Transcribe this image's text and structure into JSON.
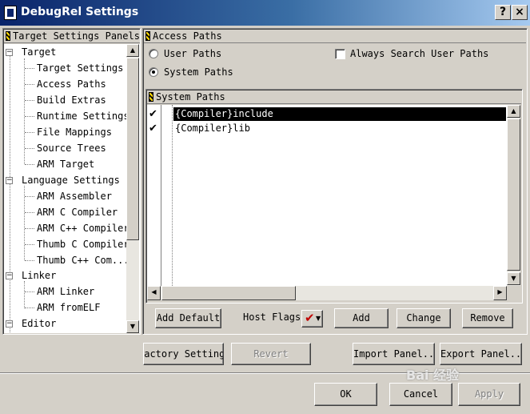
{
  "window": {
    "title": "DebugRel Settings",
    "help_label": "?",
    "close_label": "×"
  },
  "left_panel": {
    "header": "Target Settings Panels"
  },
  "tree": {
    "items": [
      {
        "label": "Target",
        "expander": "−"
      },
      {
        "label": "Target Settings"
      },
      {
        "label": "Access Paths"
      },
      {
        "label": "Build Extras"
      },
      {
        "label": "Runtime Settings"
      },
      {
        "label": "File Mappings"
      },
      {
        "label": "Source Trees"
      },
      {
        "label": "ARM Target"
      },
      {
        "label": "Language Settings",
        "expander": "−"
      },
      {
        "label": "ARM Assembler"
      },
      {
        "label": "ARM C Compiler"
      },
      {
        "label": "ARM C++ Compiler"
      },
      {
        "label": "Thumb C Compiler"
      },
      {
        "label": "Thumb C++ Com..."
      },
      {
        "label": "Linker",
        "expander": "−"
      },
      {
        "label": "ARM Linker"
      },
      {
        "label": "ARM fromELF"
      },
      {
        "label": "Editor",
        "expander": "−"
      }
    ]
  },
  "right_panel": {
    "header": "Access Paths"
  },
  "options": {
    "user_paths": "User Paths",
    "system_paths": "System Paths",
    "always_search": "Always Search User Paths",
    "selected": "system_paths",
    "always_search_checked": false
  },
  "path_list": {
    "header": "System Paths",
    "rows": [
      {
        "path": "{Compiler}include",
        "checked": true,
        "selected": true
      },
      {
        "path": "{Compiler}lib",
        "checked": true,
        "selected": false
      }
    ]
  },
  "path_buttons": {
    "add_default": "Add Default",
    "host_flags_label": "Host Flags:",
    "add": "Add",
    "change": "Change",
    "remove": "Remove"
  },
  "panel_buttons": {
    "factory_settings": "Factory Settings",
    "revert": "Revert",
    "import_panel": "Import Panel...",
    "export_panel": "Export Panel..."
  },
  "dialog_buttons": {
    "ok": "OK",
    "cancel": "Cancel",
    "apply": "Apply"
  },
  "watermark": "Bai 经验",
  "colors": {
    "title_start": "#0a246a",
    "title_end": "#a6caf0",
    "selection": "#000000",
    "face": "#d4d0c8",
    "check_red": "#c00000"
  }
}
